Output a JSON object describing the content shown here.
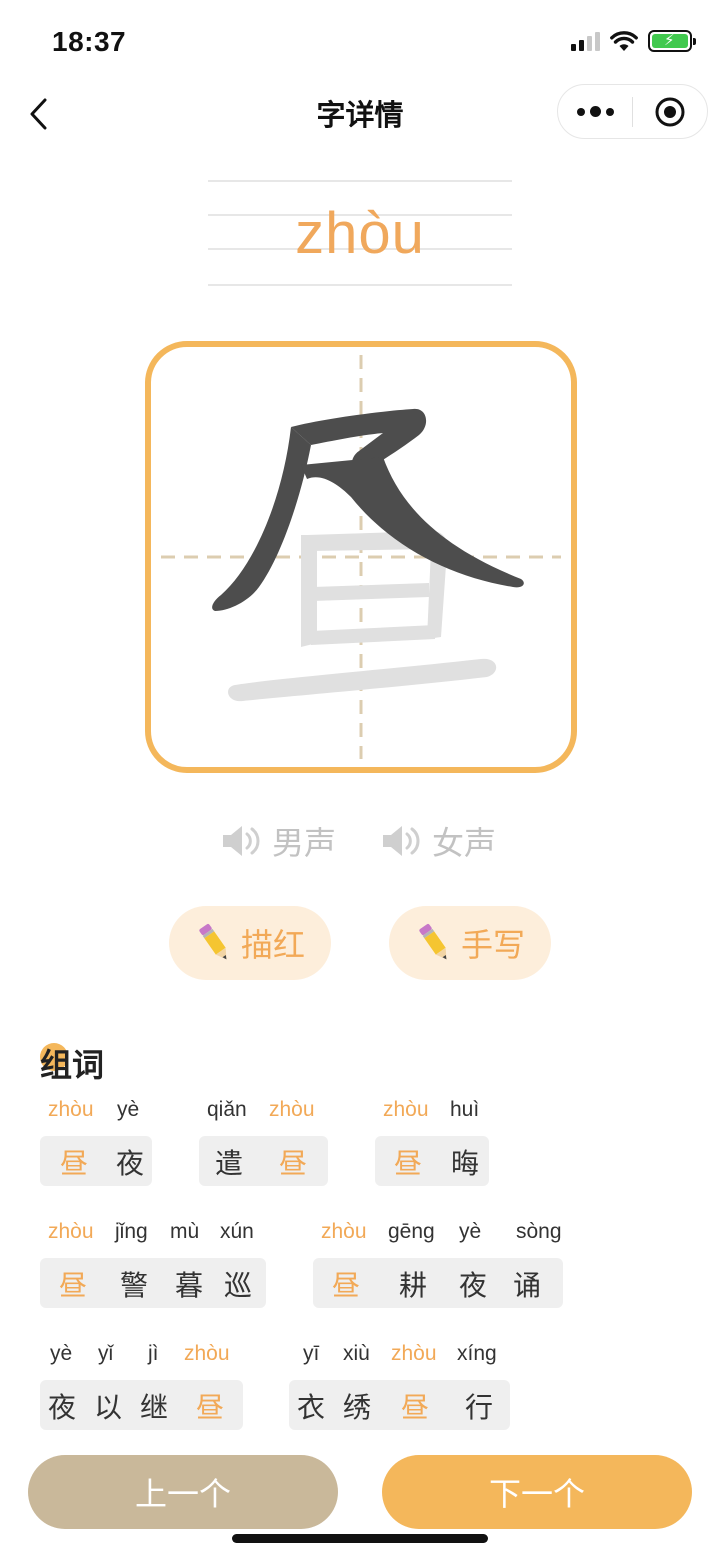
{
  "status_bar": {
    "time": "18:37",
    "icons": [
      "signal-icon",
      "wifi-icon",
      "battery-charging-icon"
    ]
  },
  "nav": {
    "title": "字详情",
    "back_icon": "chevron-left-icon",
    "more_icon": "more-dots-icon",
    "close_icon": "target-close-icon"
  },
  "character": {
    "pinyin": "zhòu",
    "hanzi": "昼",
    "strokes_shown": 3
  },
  "voice": {
    "male_label": "男声",
    "female_label": "女声",
    "icon": "speaker-icon"
  },
  "practice": {
    "trace_label": "描红",
    "write_label": "手写",
    "icon": "pencil-icon"
  },
  "words_section": {
    "title": "组词",
    "words": [
      {
        "pinyin": [
          "zhòu",
          "yè"
        ],
        "chars": [
          "昼",
          "夜"
        ],
        "highlight": 0
      },
      {
        "pinyin": [
          "qiǎn",
          "zhòu"
        ],
        "chars": [
          "遣",
          "昼"
        ],
        "highlight": 1
      },
      {
        "pinyin": [
          "zhòu",
          "huì"
        ],
        "chars": [
          "昼",
          "晦"
        ],
        "highlight": 0
      },
      {
        "pinyin": [
          "zhòu",
          "jǐng",
          "mù",
          "xún"
        ],
        "chars": [
          "昼",
          "警",
          "暮",
          "巡"
        ],
        "highlight": 0
      },
      {
        "pinyin": [
          "zhòu",
          "gēng",
          "yè",
          "sòng"
        ],
        "chars": [
          "昼",
          "耕",
          "夜",
          "诵"
        ],
        "highlight": 0
      },
      {
        "pinyin": [
          "yè",
          "yǐ",
          "jì",
          "zhòu"
        ],
        "chars": [
          "夜",
          "以",
          "继",
          "昼"
        ],
        "highlight": 3
      },
      {
        "pinyin": [
          "yī",
          "xiù",
          "zhòu",
          "xíng"
        ],
        "chars": [
          "衣",
          "绣",
          "昼",
          "行"
        ],
        "highlight": 2
      }
    ]
  },
  "bottom": {
    "prev_label": "上一个",
    "next_label": "下一个"
  },
  "colors": {
    "accent": "#f4b75b",
    "accent_text": "#f2a957",
    "pill_bg": "#fdeedb",
    "prev_button": "#c9b89a",
    "stroke_done": "#4d4d4d",
    "stroke_pending": "#e0e0e0"
  }
}
